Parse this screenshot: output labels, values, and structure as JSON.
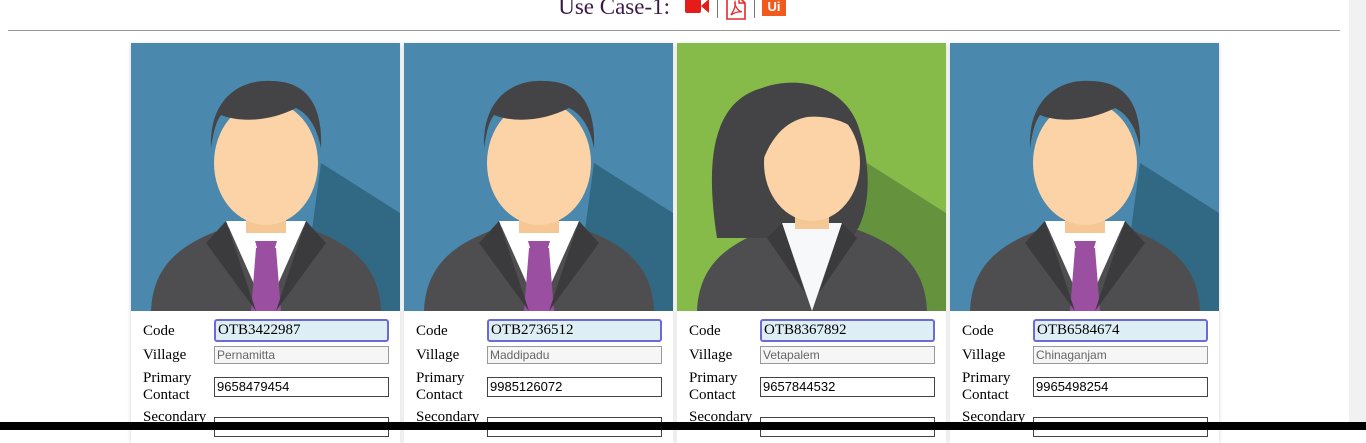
{
  "header": {
    "title": "Use Case-1:",
    "icons": [
      "video-camera-icon",
      "pdf-icon",
      "ui-icon"
    ],
    "ui_icon_text": "Ui",
    "colors": {
      "video": "#e81b1b",
      "pdf": "#e32a2a",
      "ui": "#f05a1c"
    }
  },
  "labels": {
    "code": "Code",
    "village": "Village",
    "primary_1": "Primary",
    "primary_2": "Contact",
    "secondary": "Secondary"
  },
  "cards": [
    {
      "avatar": "male",
      "bg": "#4a88ad",
      "shadow": "#2a5e76",
      "code": "OTB3422987",
      "village": "Pernamitta",
      "primary_contact": "9658479454"
    },
    {
      "avatar": "male",
      "bg": "#4a88ad",
      "shadow": "#2a5e76",
      "code": "OTB2736512",
      "village": "Maddipadu",
      "primary_contact": "9985126072"
    },
    {
      "avatar": "female",
      "bg": "#86bb4a",
      "shadow": "#5a8438",
      "code": "OTB8367892",
      "village": "Vetapalem",
      "primary_contact": "9657844532"
    },
    {
      "avatar": "male",
      "bg": "#4a88ad",
      "shadow": "#2a5e76",
      "code": "OTB6584674",
      "village": "Chinaganjam",
      "primary_contact": "9965498254"
    }
  ]
}
